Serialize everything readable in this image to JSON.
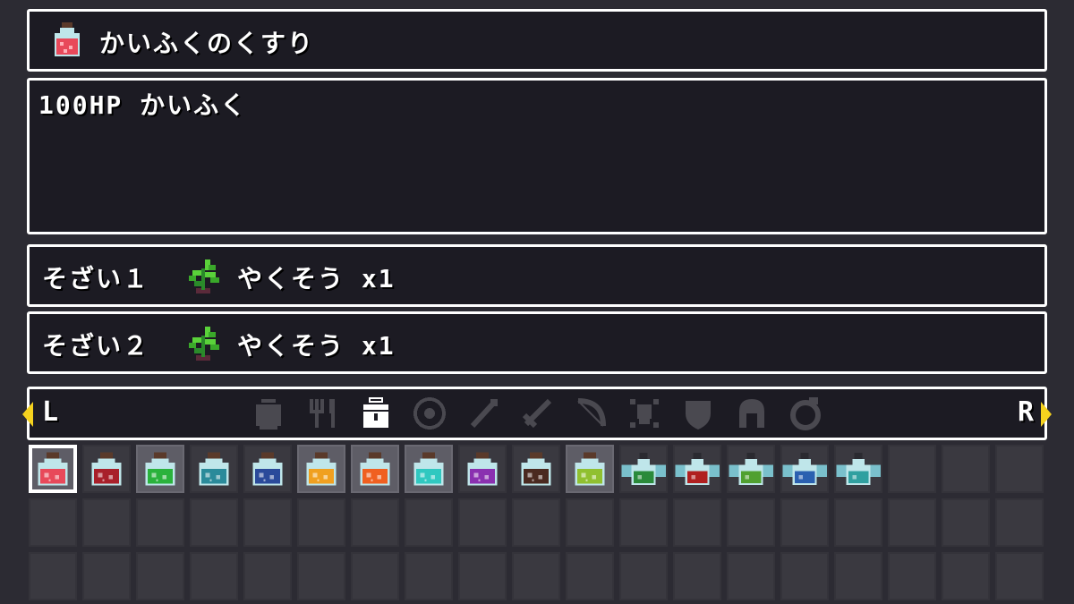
{
  "item": {
    "name": "かいふくのくすり",
    "icon": "red-potion-icon",
    "description": "100HP かいふく"
  },
  "materials": [
    {
      "label": "そざい１",
      "item_name": "やくそう x1",
      "icon": "herb-icon"
    },
    {
      "label": "そざい２",
      "item_name": "やくそう x1",
      "icon": "herb-icon"
    }
  ],
  "tabs": {
    "left_key": "L",
    "right_key": "R",
    "active_index": 2,
    "icons": [
      "pot-icon",
      "fork-knife-icon",
      "potion-bag-icon",
      "target-icon",
      "wand-icon",
      "sword-icon",
      "bow-icon",
      "skull-crossbones-icon",
      "shield-icon",
      "helmet-icon",
      "ring-icon"
    ]
  },
  "inventory": {
    "selected_index": 0,
    "items": [
      {
        "icon": "potion-icon",
        "color": "#e8495a"
      },
      {
        "icon": "potion-icon",
        "color": "#a8202a"
      },
      {
        "icon": "potion-icon",
        "color": "#2ab23c"
      },
      {
        "icon": "potion-icon",
        "color": "#2a8a9a"
      },
      {
        "icon": "potion-icon",
        "color": "#2a4a9a"
      },
      {
        "icon": "potion-icon",
        "color": "#f0a020"
      },
      {
        "icon": "potion-icon",
        "color": "#f06020"
      },
      {
        "icon": "potion-icon",
        "color": "#30c8c0"
      },
      {
        "icon": "potion-icon",
        "color": "#8a30b0"
      },
      {
        "icon": "potion-icon",
        "color": "#4a2a20"
      },
      {
        "icon": "potion-icon",
        "color": "#90c030"
      },
      {
        "icon": "winged-flask-icon",
        "color": "#2a8a3a"
      },
      {
        "icon": "winged-flask-icon",
        "color": "#b02020"
      },
      {
        "icon": "winged-flask-icon",
        "color": "#50a030"
      },
      {
        "icon": "winged-flask-icon",
        "color": "#2a60b0"
      },
      {
        "icon": "winged-flask-icon",
        "color": "#30a0a0"
      }
    ],
    "highlighted_slots": [
      2,
      5,
      6,
      7,
      10
    ],
    "rows": 3,
    "columns": 19
  }
}
